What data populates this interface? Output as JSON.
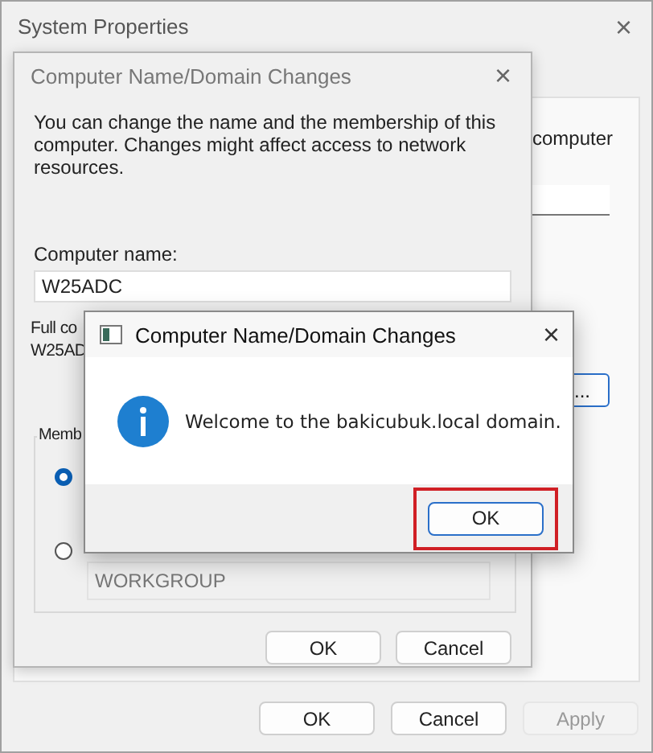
{
  "system_properties": {
    "title": "System Properties",
    "close": "×",
    "partial_text": "computer",
    "partial_button": "...",
    "buttons": [
      {
        "label": "OK",
        "disabled": false
      },
      {
        "label": "Cancel",
        "disabled": false
      },
      {
        "label": "Apply",
        "disabled": true
      }
    ]
  },
  "domain_dialog": {
    "title": "Computer Name/Domain Changes",
    "active": false,
    "close": "×",
    "description": "You can change the name and the membership of this computer. Changes might affect access to network resources.",
    "computer_name_label": "Computer name:",
    "computer_name": "W25ADC",
    "full_name_label": "Full co",
    "full_name": "W25AD",
    "membership_label": "Memb",
    "options": [
      {
        "selected": true
      },
      {
        "selected": false
      }
    ],
    "workgroup": "WORKGROUP",
    "buttons": [
      "OK",
      "Cancel"
    ]
  },
  "message_box": {
    "title": "Computer Name/Domain Changes",
    "close": "×",
    "message": "Welcome to the bakicubuk.local domain.",
    "button": "OK",
    "highlighted": true
  }
}
